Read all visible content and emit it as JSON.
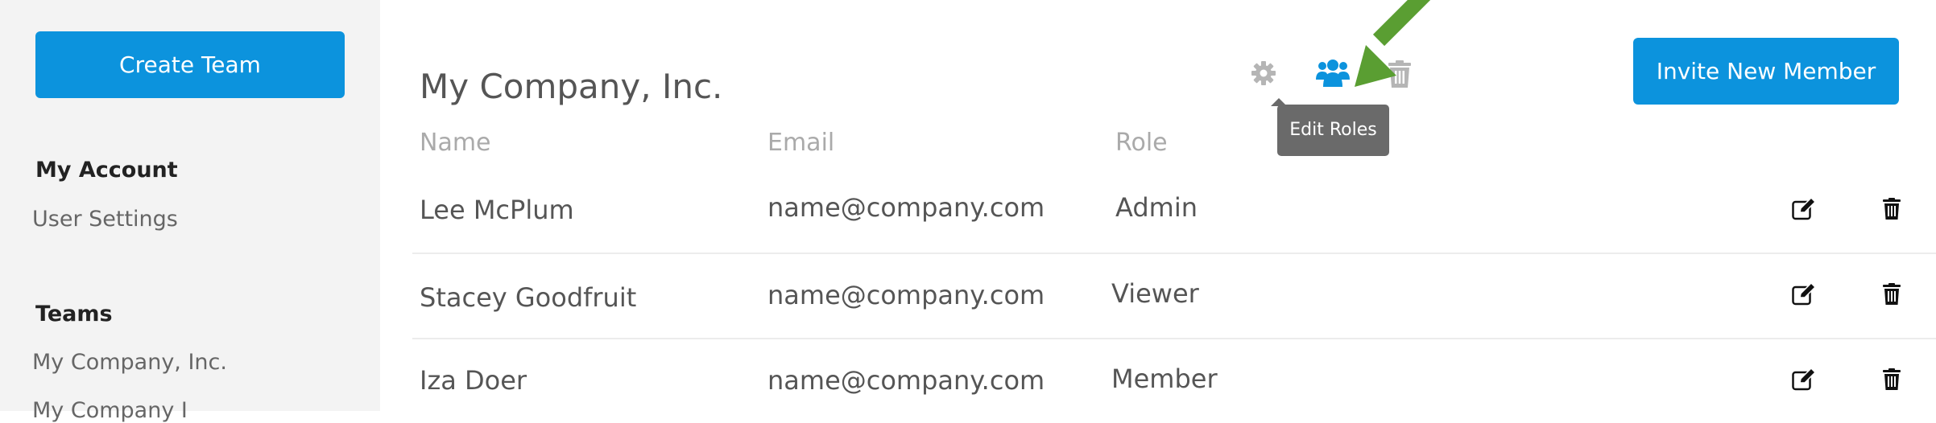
{
  "sidebar": {
    "create_button": "Create Team",
    "account_heading": "My Account",
    "account_link": "User Settings",
    "teams_heading": "Teams",
    "teams": [
      "My Company, Inc.",
      "My Company I"
    ]
  },
  "main": {
    "title": "My Company, Inc.",
    "tooltip": "Edit Roles",
    "invite_button": "Invite New Member",
    "columns": [
      "Name",
      "Email",
      "Role"
    ],
    "members": [
      {
        "name": "Lee McPlum",
        "email": "name@company.com",
        "role": "Admin"
      },
      {
        "name": "Stacey Goodfruit",
        "email": "name@company.com",
        "role": "Viewer"
      },
      {
        "name": "Iza Doer",
        "email": "name@company.com",
        "role": "Member"
      }
    ]
  },
  "icons": {
    "settings": "gear-icon",
    "roles": "users-icon",
    "delete_team": "trash-icon",
    "row_edit": "edit-icon",
    "row_delete": "trash-icon",
    "annotation": "arrow-icon"
  },
  "colors": {
    "accent": "#0c93dd",
    "icon_gray": "#b5b5b5",
    "tooltip_bg": "#6a6a6a",
    "arrow": "#5a9e32",
    "sidebar_bg": "#f3f3f3"
  }
}
